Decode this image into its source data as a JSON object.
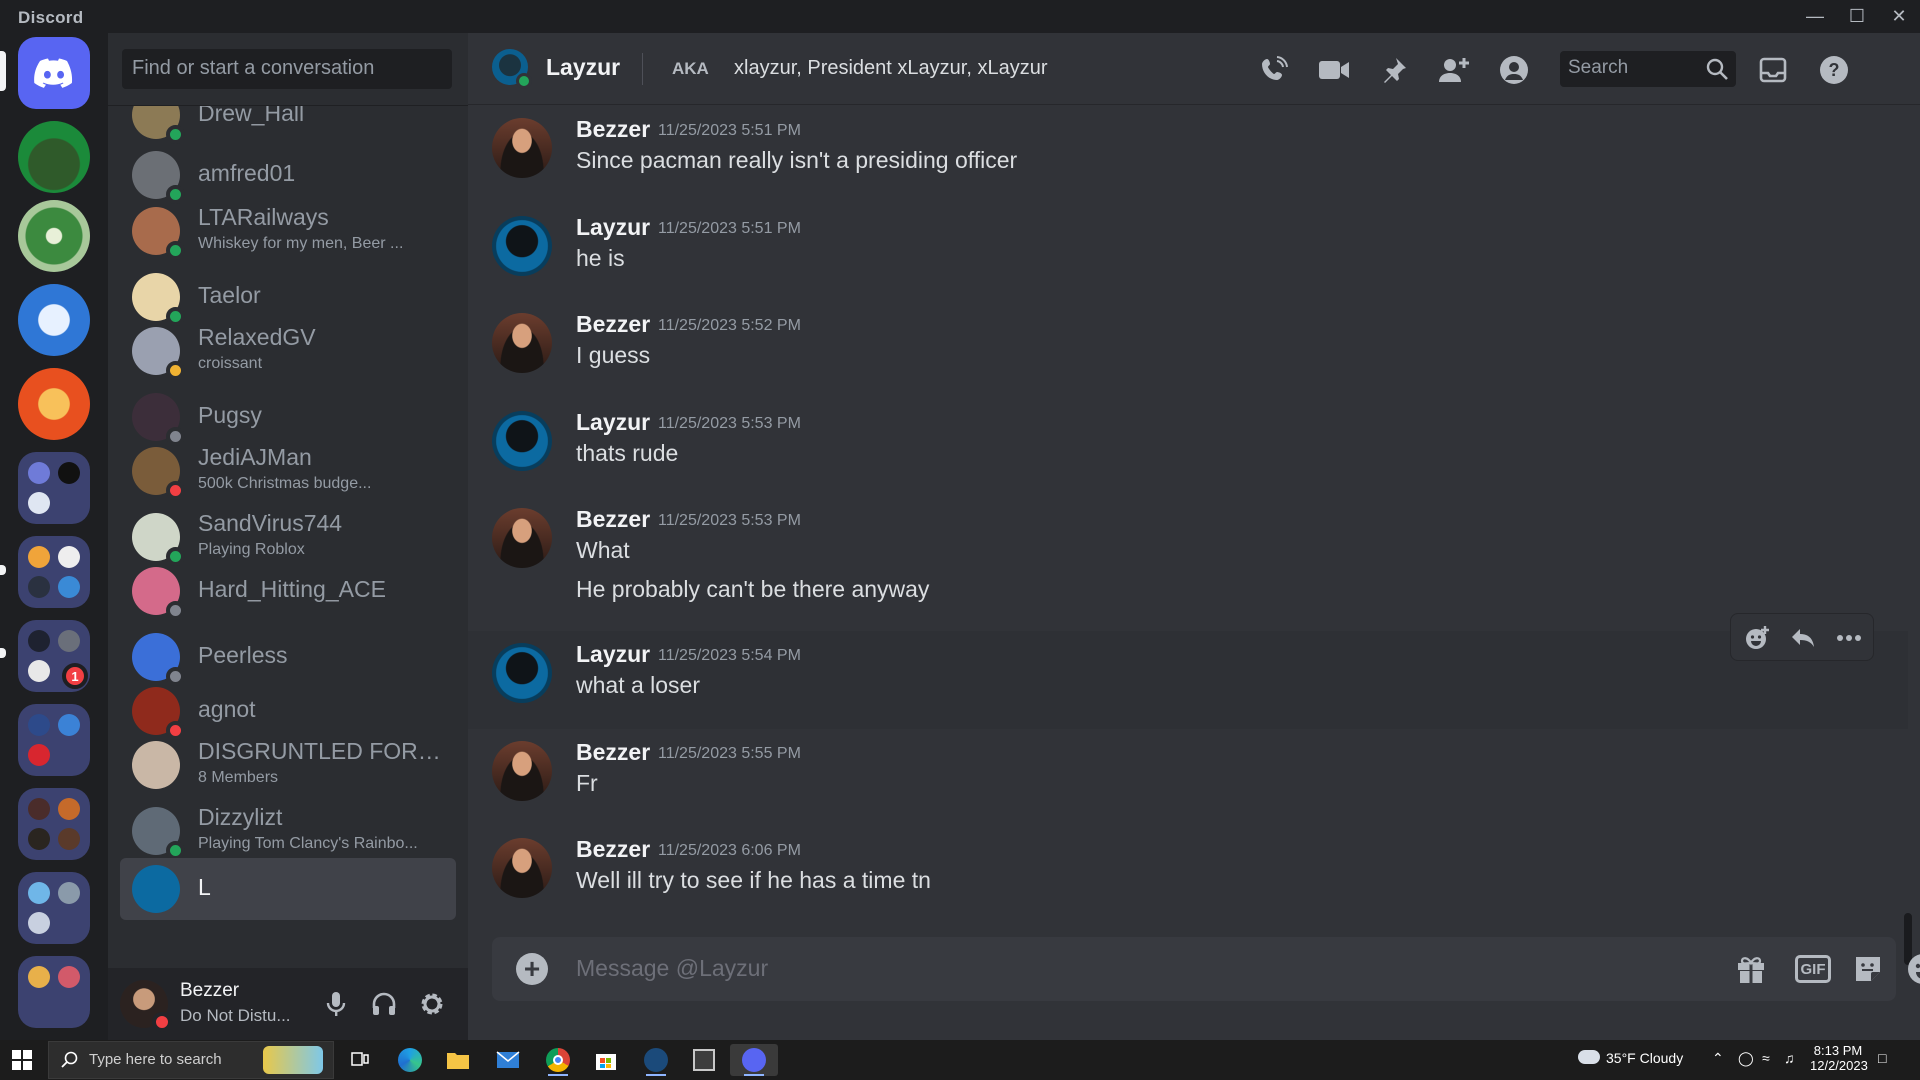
{
  "titlebar": {
    "app_name": "Discord"
  },
  "dm_sidebar": {
    "search_placeholder": "Find or start a conversation",
    "items": [
      {
        "name": "Drew_Hall",
        "sub": "",
        "status": "mobile",
        "avatar_color": "#8c7a55"
      },
      {
        "name": "amfred01",
        "sub": "",
        "status": "online",
        "avatar_color": "#6b6f75"
      },
      {
        "name": "LTARailways",
        "sub": "Whiskey for my men, Beer ...",
        "status": "online",
        "avatar_color": "#a86b4c"
      },
      {
        "name": "Taelor",
        "sub": "",
        "status": "online",
        "avatar_color": "#e8d5a8"
      },
      {
        "name": "RelaxedGV",
        "sub": "croissant",
        "status": "idle",
        "avatar_color": "#9aa0b0"
      },
      {
        "name": "Pugsy",
        "sub": "",
        "status": "offline",
        "avatar_color": "#3c2e3a"
      },
      {
        "name": "JediAJMan",
        "sub": "500k Christmas budge...",
        "status": "dnd",
        "avatar_color": "#7a5c3a"
      },
      {
        "name": "SandVirus744",
        "sub": "Playing Roblox",
        "status": "online",
        "avatar_color": "#cfd6c8"
      },
      {
        "name": "Hard_Hitting_ACE",
        "sub": "",
        "status": "offline",
        "avatar_color": "#d46a8a"
      },
      {
        "name": "Peerless",
        "sub": "",
        "status": "offline",
        "avatar_color": "#3b6fd8"
      },
      {
        "name": "agnot",
        "sub": "",
        "status": "dnd",
        "avatar_color": "#8f2a1c"
      },
      {
        "name": "DISGRUNTLED FORM...",
        "sub": "8 Members",
        "status": "none",
        "avatar_color": "#c9b7a6"
      },
      {
        "name": "Dizzylizt",
        "sub": "Playing Tom Clancy's Rainbo...",
        "status": "online",
        "avatar_color": "#5f6a76"
      }
    ],
    "partial_item": "L"
  },
  "user_panel": {
    "username": "Bezzer",
    "status_text": "Do Not Distu..."
  },
  "header": {
    "name": "Layzur",
    "aka_label": "AKA",
    "aka_values": "xlayzur, President xLayzur, xLayzur",
    "search_placeholder": "Search"
  },
  "messages": [
    {
      "author": "Bezzer",
      "timestamp": "11/25/2023 5:51 PM",
      "lines": [
        "Since pacman really isn't a presiding officer"
      ]
    },
    {
      "author": "Layzur",
      "timestamp": "11/25/2023 5:51 PM",
      "lines": [
        "he is"
      ]
    },
    {
      "author": "Bezzer",
      "timestamp": "11/25/2023 5:52 PM",
      "lines": [
        "I guess"
      ]
    },
    {
      "author": "Layzur",
      "timestamp": "11/25/2023 5:53 PM",
      "lines": [
        "thats rude"
      ]
    },
    {
      "author": "Bezzer",
      "timestamp": "11/25/2023 5:53 PM",
      "lines": [
        "What",
        "He probably can't be there anyway"
      ]
    },
    {
      "author": "Layzur",
      "timestamp": "11/25/2023 5:54 PM",
      "lines": [
        "what a loser"
      ]
    },
    {
      "author": "Bezzer",
      "timestamp": "11/25/2023 5:55 PM",
      "lines": [
        "Fr"
      ]
    },
    {
      "author": "Bezzer",
      "timestamp": "11/25/2023 6:06 PM",
      "lines": [
        "Well ill try to see if he has a time tn"
      ]
    }
  ],
  "composer": {
    "placeholder": "Message @Layzur",
    "gif_label": "GIF"
  },
  "rail": {
    "notification_badge": "1"
  },
  "taskbar": {
    "search_placeholder": "Type here to search",
    "weather": "35°F  Cloudy",
    "time": "8:13 PM",
    "date": "12/2/2023"
  },
  "colors": {
    "online": "#23a55a",
    "idle": "#f0b232",
    "dnd": "#f23f43",
    "offline": "#80848e",
    "blurple": "#5865f2"
  }
}
